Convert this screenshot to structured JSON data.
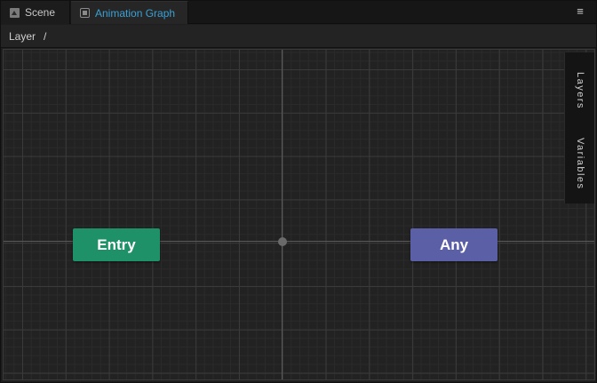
{
  "tabs": [
    {
      "label": "Scene",
      "icon": "scene-icon",
      "active": false
    },
    {
      "label": "Animation Graph",
      "icon": "animation-graph-icon",
      "active": true
    }
  ],
  "menu": {
    "icon": "hamburger-menu-icon",
    "glyph": "≡"
  },
  "breadcrumb": {
    "label": "Layer",
    "separator": "/"
  },
  "graph": {
    "nodes": [
      {
        "label": "Entry",
        "color": "#1e9168"
      },
      {
        "label": "Any",
        "color": "#5b5fa6"
      }
    ],
    "accent_color": "#3aa1d6"
  },
  "side_panel": {
    "tabs": [
      {
        "label": "Layers"
      },
      {
        "label": "Variables"
      }
    ]
  }
}
